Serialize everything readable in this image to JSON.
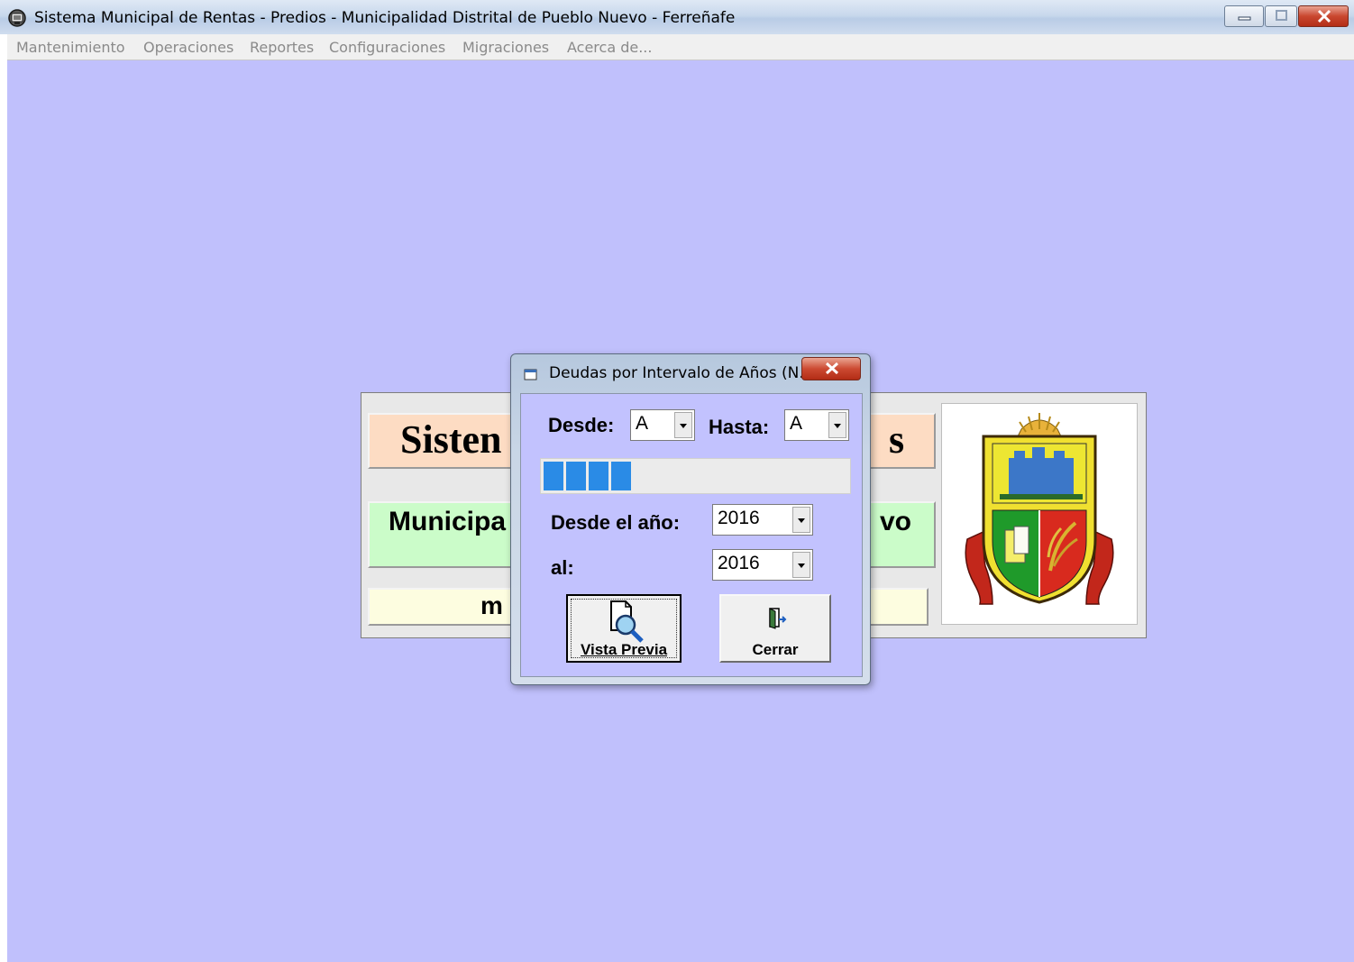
{
  "window": {
    "title": "Sistema Municipal de Rentas - Predios - Municipalidad Distrital de Pueblo Nuevo - Ferreñafe"
  },
  "menu": {
    "items": [
      {
        "label": "Mantenimiento"
      },
      {
        "label": "Operaciones"
      },
      {
        "label": "Reportes"
      },
      {
        "label": "Configuraciones"
      },
      {
        "label": "Migraciones"
      },
      {
        "label": "Acerca de..."
      }
    ]
  },
  "background_panel": {
    "band1_left": "Sisten",
    "band1_right": "s",
    "band2_left": "Municipa",
    "band2_right": "vo",
    "band3_left": "m"
  },
  "dialog": {
    "title": "Deudas por Intervalo de Años (N...",
    "desde_label": "Desde:",
    "desde_value": "A",
    "hasta_label": "Hasta:",
    "hasta_value": "A",
    "progress_percent": 36,
    "desde_anio_label": "Desde el año:",
    "desde_anio_value": "2016",
    "al_label": "al:",
    "al_value": "2016",
    "preview_button": "Vista Previa",
    "close_button": "Cerrar"
  },
  "colors": {
    "workspace_bg": "#c0c0fc",
    "dialog_client_bg": "#c2c2fe",
    "progress_fill": "#2a8be6",
    "band1_bg": "#fddcc3",
    "band2_bg": "#cbfcc9",
    "band3_bg": "#fdfde0"
  }
}
